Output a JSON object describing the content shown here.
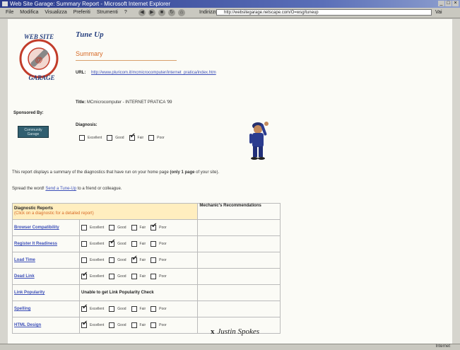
{
  "window": {
    "title": "Web Site Garage: Summary Report - Microsoft Internet Explorer",
    "controls": [
      "_",
      "□",
      "×"
    ]
  },
  "toolbar": {
    "menu": [
      "File",
      "Modifica",
      "Visualizza",
      "Preferiti",
      "Strumenti",
      "?"
    ],
    "nav_icons": [
      "back-icon",
      "forward-icon",
      "stop-icon",
      "refresh-icon",
      "home-icon"
    ],
    "address_label": "Indirizzo",
    "address_value": "http://websitegarage.netscape.com/O=wsg/tuneup",
    "go_label": "Vai"
  },
  "page": {
    "logo": {
      "top": "WEB SITE",
      "bottom": "GARAGE"
    },
    "heading": "Tune Up",
    "summary_label": "Summary",
    "url_label": "URL:",
    "url_value": "http://www.pluricom.it/mcmicrocomputer/internet_pratica/index.htm",
    "title_label": "Title:",
    "title_value": "MCmicrocomputer - INTERNET PRATICA '99",
    "sponsored_label": "Sponsored By:",
    "sponsor_button": "Community Garage",
    "diagnosis_label": "Diagnosis:",
    "diagnosis": {
      "options": [
        "Excellent",
        "Good",
        "Fair",
        "Poor"
      ],
      "checked": "Fair"
    },
    "report_text_before": "This report displays a summary of the diagnostics that have run on your home page ",
    "report_text_bold": "(only 1 page",
    "report_text_after": " of your site).",
    "spread_before": "Spread the word! ",
    "spread_link": "Send a Tune-Up",
    "spread_after": " to a friend or colleague.",
    "table": {
      "head_title": "Diagnostic Reports",
      "head_sub": "(Click on a diagnostic for a detailed report)",
      "head_right": "Mechanic's Recommendations",
      "options": [
        "Excellent",
        "Good",
        "Fair",
        "Poor"
      ],
      "rows": [
        {
          "name": "Browser Compatibility",
          "checked": "Poor"
        },
        {
          "name": "Register It Readiness",
          "checked": "Good"
        },
        {
          "name": "Load Time",
          "checked": "Fair"
        },
        {
          "name": "Dead Link",
          "checked": "Excellent"
        },
        {
          "name": "Link Popularity",
          "message": "Unable to get Link Popularity Check"
        },
        {
          "name": "Spelling",
          "checked": "Excellent"
        },
        {
          "name": "HTML Design",
          "checked": "Excellent"
        }
      ]
    },
    "signature_x": "x",
    "signature": "Justin Spokes"
  },
  "status": {
    "zone": "Internet"
  },
  "colors": {
    "link": "#3c4fb8",
    "accent": "#d76a26",
    "heading": "#27407f"
  }
}
